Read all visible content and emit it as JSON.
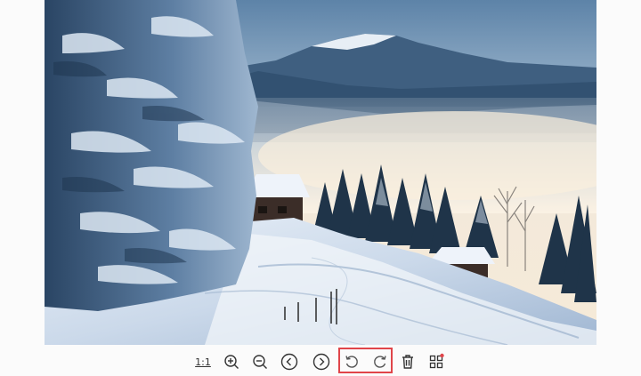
{
  "toolbar": {
    "actual_size_label": "1:1",
    "buttons": [
      {
        "name": "actual-size-button",
        "icon": "one-to-one-icon"
      },
      {
        "name": "zoom-in-button",
        "icon": "zoom-in-icon"
      },
      {
        "name": "zoom-out-button",
        "icon": "zoom-out-icon"
      },
      {
        "name": "previous-button",
        "icon": "chevron-left-circle-icon"
      },
      {
        "name": "next-button",
        "icon": "chevron-right-circle-icon"
      },
      {
        "name": "rotate-left-button",
        "icon": "rotate-ccw-icon"
      },
      {
        "name": "rotate-right-button",
        "icon": "rotate-cw-icon"
      },
      {
        "name": "delete-button",
        "icon": "trash-icon"
      },
      {
        "name": "thumbnails-button",
        "icon": "grid-icon"
      }
    ],
    "highlight_color": "#e0454a",
    "notification_dot_color": "#e0454a"
  },
  "image": {
    "subject": "snowy-mountain-landscape"
  }
}
